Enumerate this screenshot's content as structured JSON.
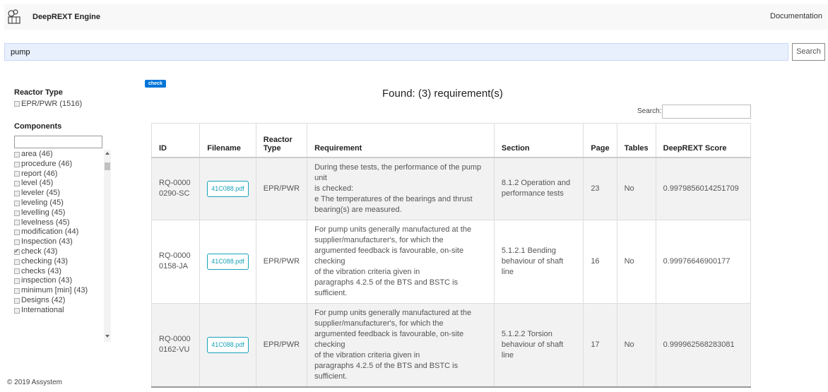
{
  "app": {
    "title": "DeepREXT Engine",
    "nav_link": "Documentation"
  },
  "search": {
    "value": "pump",
    "button": "Search"
  },
  "sidebar": {
    "reactor_title": "Reactor Type",
    "reactor_options": [
      {
        "label": "EPR/PWR (1516)",
        "checked": false
      }
    ],
    "components_title": "Components",
    "components": [
      {
        "label": "area (46)",
        "checked": false
      },
      {
        "label": "procedure (46)",
        "checked": false
      },
      {
        "label": "report (46)",
        "checked": false
      },
      {
        "label": "level (45)",
        "checked": false
      },
      {
        "label": "leveler (45)",
        "checked": false
      },
      {
        "label": "leveling (45)",
        "checked": false
      },
      {
        "label": "levelling (45)",
        "checked": false
      },
      {
        "label": "levelness (45)",
        "checked": false
      },
      {
        "label": "modification (44)",
        "checked": false
      },
      {
        "label": "Inspection (43)",
        "checked": false
      },
      {
        "label": "check (43)",
        "checked": true
      },
      {
        "label": "checking (43)",
        "checked": false
      },
      {
        "label": "checks (43)",
        "checked": false
      },
      {
        "label": "inspection (43)",
        "checked": false
      },
      {
        "label": "minimum [min] (43)",
        "checked": false
      },
      {
        "label": "Designs (42)",
        "checked": false
      },
      {
        "label": "International",
        "checked": false
      }
    ]
  },
  "main": {
    "active_tag": "check",
    "found_label": "Found: (3) requirement(s)",
    "table_search_label": "Search:",
    "columns": [
      "ID",
      "Filename",
      "Reactor Type",
      "Requirement",
      "Section",
      "Page",
      "Tables",
      "DeepREXT Score"
    ],
    "rows": [
      {
        "id": "RQ-00000290-SC",
        "filename": "41C088.pdf",
        "reactor": "EPR/PWR",
        "requirement": [
          "During these tests, the performance of the pump unit",
          "is checked:",
          "e The temperatures of the bearings and thrust",
          "bearing(s) are measured."
        ],
        "section": "8.1.2 Operation and performance tests",
        "page": "23",
        "tables": "No",
        "score": "0.9979856014251709"
      },
      {
        "id": "RQ-00000158-JA",
        "filename": "41C088.pdf",
        "reactor": "EPR/PWR",
        "requirement": [
          "For pump units generally manufactured at the",
          "supplier/manufacturer's, for which the",
          "argumented feedback is favourable, on-site checking",
          "of the vibration criteria given in",
          "paragraphs 4.2.5 of the BTS and BSTC is sufficient."
        ],
        "section": "5.1.2.1 Bending behaviour of shaft line",
        "page": "16",
        "tables": "No",
        "score": "0.99976646900177"
      },
      {
        "id": "RQ-00000162-VU",
        "filename": "41C088.pdf",
        "reactor": "EPR/PWR",
        "requirement": [
          "For pump units generally manufactured at the",
          "supplier/manufacturer's, for which the",
          "argumented feedback is favourable, on-site checking",
          "of the vibration criteria given in",
          "paragraphs 4.2.5 of the BTS and BSTC is sufficient."
        ],
        "section": "5.1.2.2 Torsion behaviour of shaft line",
        "page": "17",
        "tables": "No",
        "score": "0.999962568283081"
      }
    ]
  },
  "footer": {
    "text": "© 2019 Assystem"
  }
}
